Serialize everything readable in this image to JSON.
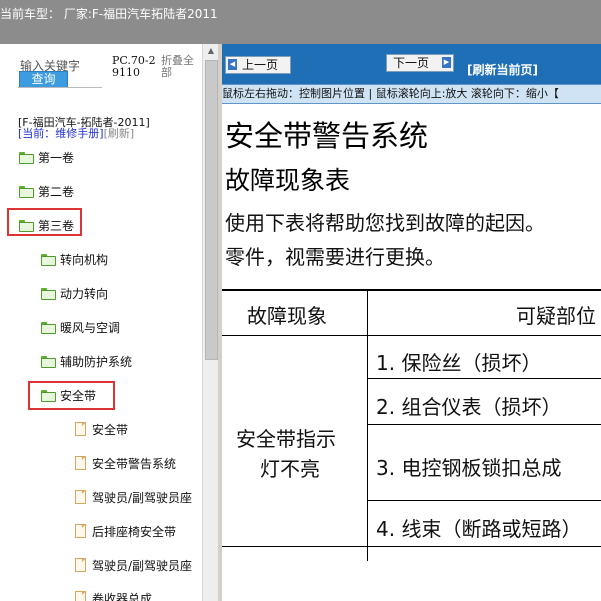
{
  "window": {
    "title": "当前车型：  厂家:F-福田汽车拓陆者2011"
  },
  "search": {
    "hint": "输入关键字",
    "button": "查询",
    "pc_code": "PC.70-29110",
    "collapse_all": "折叠全部"
  },
  "tree_header": {
    "model": "[F-福田汽车-拓陆者-2011]",
    "current": "[当前：维修手册]",
    "refresh": "[刷新]"
  },
  "tree": {
    "vol1": "第一卷",
    "vol2": "第二卷",
    "vol3": "第三卷",
    "steering": "转向机构",
    "power_steering": "动力转向",
    "hvac": "暖风与空调",
    "srs": "辅助防护系统",
    "seatbelt": "安全带",
    "doc1": "安全带",
    "doc2": "安全带警告系统",
    "doc3": "驾驶员/副驾驶员座",
    "doc4": "后排座椅安全带",
    "doc5": "驾驶员/副驾驶员座",
    "doc6": "卷收器总成"
  },
  "viewer": {
    "prev": "上一页",
    "next": "下一页",
    "refresh": "[刷新当前页]",
    "hint": "鼠标左右拖动：控制图片位置  |  鼠标滚轮向上:放大  滚轮向下：缩小【"
  },
  "doc": {
    "title": "安全带警告系统",
    "subtitle": "故障现象表",
    "para_line1": "使用下表将帮助您找到故障的起因。",
    "para_line2": "零件，视需要进行更换。",
    "table": {
      "col1": "故障现象",
      "col2": "可疑部位",
      "symptom_line1": "安全带指示",
      "symptom_line2": "灯不亮",
      "items": [
        "1. 保险丝（损坏）",
        "2. 组合仪表（损坏）",
        "3. 电控钢板锁扣总成",
        "4. 线束（断路或短路）"
      ]
    }
  }
}
